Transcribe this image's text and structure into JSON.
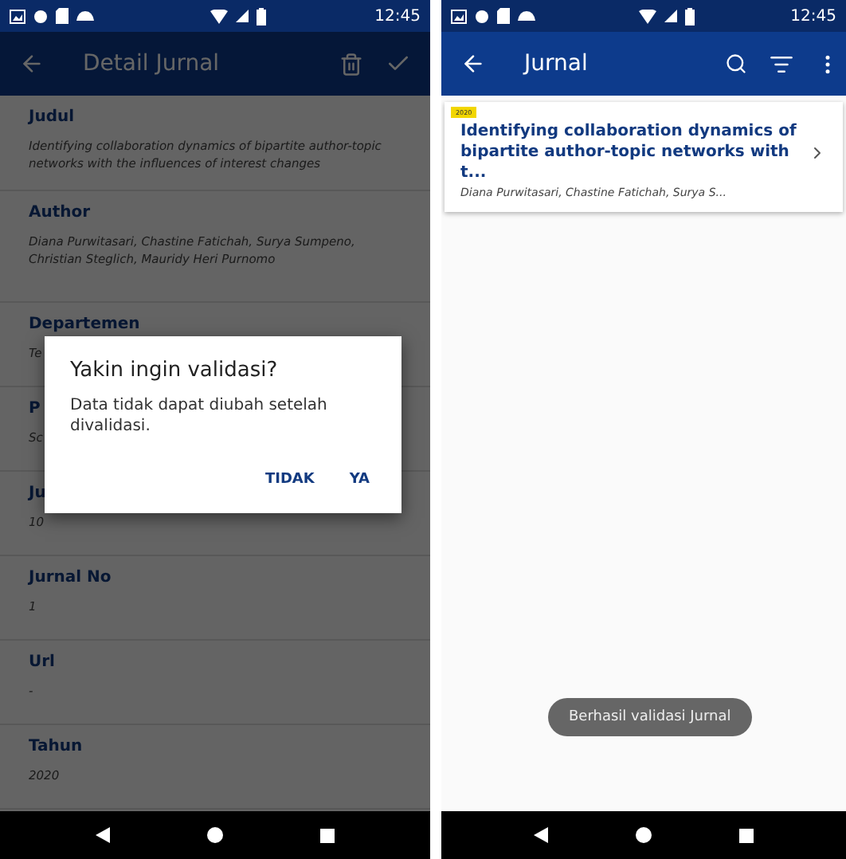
{
  "left_screen": {
    "status_bar": {
      "time": "12:45"
    },
    "app_bar": {
      "title": "Detail Jurnal"
    },
    "fields": [
      {
        "label": "Judul",
        "value": "Identifying collaboration dynamics of bipartite author-topic networks with the influences of interest changes"
      },
      {
        "label": "Author",
        "value": "Diana Purwitasari, Chastine Fatichah, Surya Sumpeno, Christian Steglich, Mauridy Heri Purnomo"
      },
      {
        "label": "Departemen",
        "value": "Te"
      },
      {
        "label": "P",
        "value": "Sc"
      },
      {
        "label": "Ju",
        "value": "10"
      },
      {
        "label": "Jurnal No",
        "value": "1"
      },
      {
        "label": "Url",
        "value": "-"
      },
      {
        "label": "Tahun",
        "value": "2020"
      }
    ],
    "dialog": {
      "title": "Yakin ingin validasi?",
      "message": "Data tidak dapat diubah setelah divalidasi.",
      "buttons": [
        "TIDAK",
        "YA"
      ]
    }
  },
  "right_screen": {
    "status_bar": {
      "time": "12:45"
    },
    "app_bar": {
      "title": "Jurnal"
    },
    "items": [
      {
        "year": "2020",
        "title": "Identifying collaboration dynamics of bipartite author-topic networks with t...",
        "authors": "Diana Purwitasari, Chastine Fatichah, Surya S..."
      }
    ],
    "toast": "Berhasil validasi Jurnal"
  }
}
